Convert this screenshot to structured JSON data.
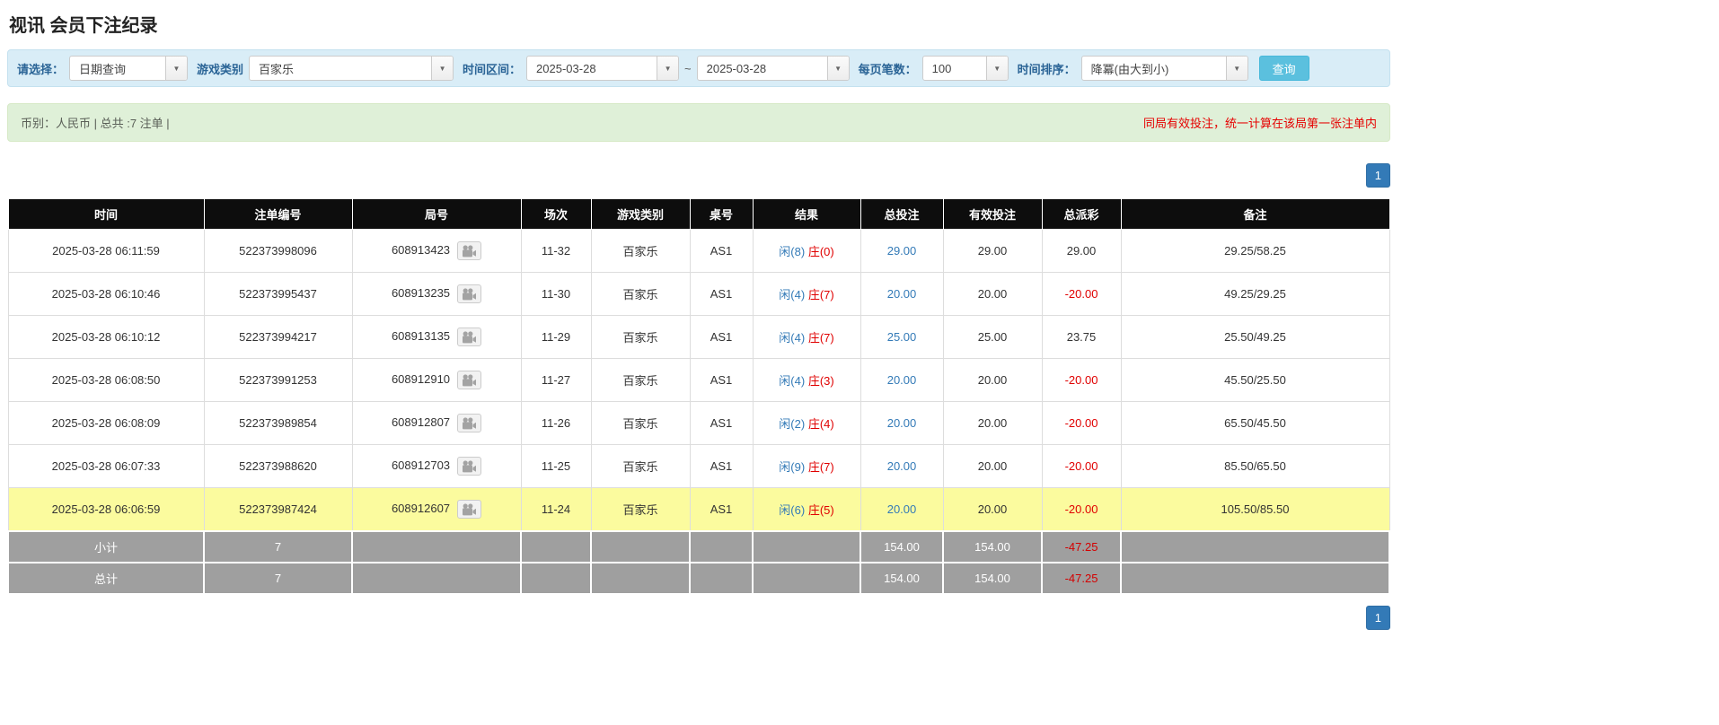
{
  "page": {
    "title": "视讯 会员下注纪录"
  },
  "ui": {
    "caret": "▼"
  },
  "filters": {
    "select_label": "请选择：",
    "select_value": "日期查询",
    "game_type_label": "游戏类别",
    "game_type_value": "百家乐",
    "time_range_label": "时间区间：",
    "time_from": "2025-03-28",
    "tilde": "~",
    "time_to": "2025-03-28",
    "page_size_label": "每页笔数：",
    "page_size_value": "100",
    "sort_label": "时间排序：",
    "sort_value": "降冪(由大到小)",
    "search_button": "查询"
  },
  "summary": {
    "left": "币别：人民币 | 总共 :7 注单 |",
    "right": "同局有效投注，统一计算在该局第一张注单内"
  },
  "pagination": {
    "page": "1"
  },
  "table": {
    "headers": [
      "时间",
      "注单编号",
      "局号",
      "场次",
      "游戏类别",
      "桌号",
      "结果",
      "总投注",
      "有效投注",
      "总派彩",
      "备注"
    ],
    "rows": [
      {
        "time": "2025-03-28 06:11:59",
        "bet_id": "522373998096",
        "round": "608913423",
        "session": "11-32",
        "game": "百家乐",
        "table_no": "AS1",
        "result_player": "闲(8)",
        "result_banker": "庄(0)",
        "total_bet": "29.00",
        "valid_bet": "29.00",
        "payout": "29.00",
        "note": "29.25/58.25",
        "highlight": false
      },
      {
        "time": "2025-03-28 06:10:46",
        "bet_id": "522373995437",
        "round": "608913235",
        "session": "11-30",
        "game": "百家乐",
        "table_no": "AS1",
        "result_player": "闲(4)",
        "result_banker": "庄(7)",
        "total_bet": "20.00",
        "valid_bet": "20.00",
        "payout": "-20.00",
        "note": "49.25/29.25",
        "highlight": false
      },
      {
        "time": "2025-03-28 06:10:12",
        "bet_id": "522373994217",
        "round": "608913135",
        "session": "11-29",
        "game": "百家乐",
        "table_no": "AS1",
        "result_player": "闲(4)",
        "result_banker": "庄(7)",
        "total_bet": "25.00",
        "valid_bet": "25.00",
        "payout": "23.75",
        "note": "25.50/49.25",
        "highlight": false
      },
      {
        "time": "2025-03-28 06:08:50",
        "bet_id": "522373991253",
        "round": "608912910",
        "session": "11-27",
        "game": "百家乐",
        "table_no": "AS1",
        "result_player": "闲(4)",
        "result_banker": "庄(3)",
        "total_bet": "20.00",
        "valid_bet": "20.00",
        "payout": "-20.00",
        "note": "45.50/25.50",
        "highlight": false
      },
      {
        "time": "2025-03-28 06:08:09",
        "bet_id": "522373989854",
        "round": "608912807",
        "session": "11-26",
        "game": "百家乐",
        "table_no": "AS1",
        "result_player": "闲(2)",
        "result_banker": "庄(4)",
        "total_bet": "20.00",
        "valid_bet": "20.00",
        "payout": "-20.00",
        "note": "65.50/45.50",
        "highlight": false
      },
      {
        "time": "2025-03-28 06:07:33",
        "bet_id": "522373988620",
        "round": "608912703",
        "session": "11-25",
        "game": "百家乐",
        "table_no": "AS1",
        "result_player": "闲(9)",
        "result_banker": "庄(7)",
        "total_bet": "20.00",
        "valid_bet": "20.00",
        "payout": "-20.00",
        "note": "85.50/65.50",
        "highlight": false
      },
      {
        "time": "2025-03-28 06:06:59",
        "bet_id": "522373987424",
        "round": "608912607",
        "session": "11-24",
        "game": "百家乐",
        "table_no": "AS1",
        "result_player": "闲(6)",
        "result_banker": "庄(5)",
        "total_bet": "20.00",
        "valid_bet": "20.00",
        "payout": "-20.00",
        "note": "105.50/85.50",
        "highlight": true
      }
    ],
    "subtotal": {
      "label": "小计",
      "count": "7",
      "total_bet": "154.00",
      "valid_bet": "154.00",
      "payout": "-47.25"
    },
    "total": {
      "label": "总计",
      "count": "7",
      "total_bet": "154.00",
      "valid_bet": "154.00",
      "payout": "-47.25"
    }
  }
}
